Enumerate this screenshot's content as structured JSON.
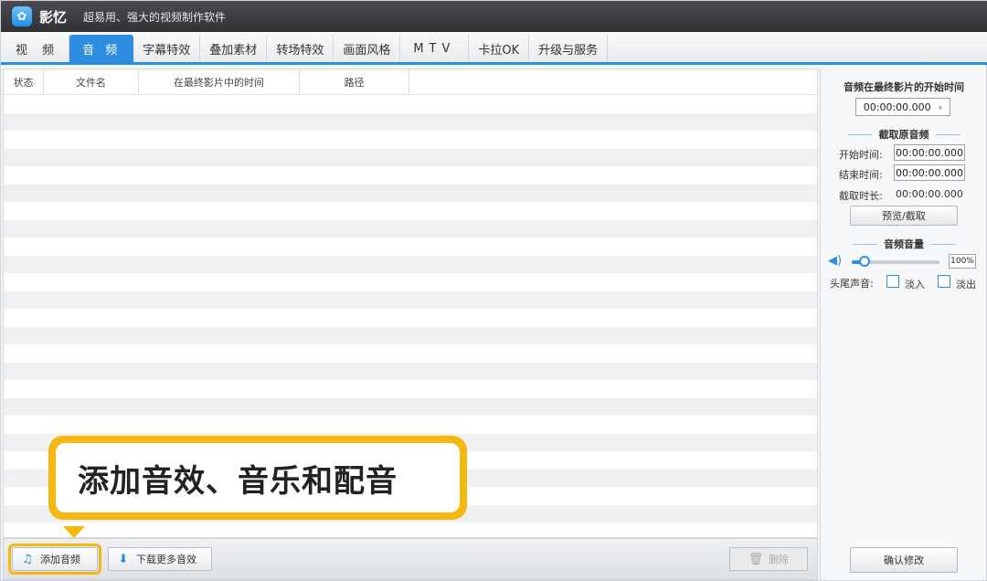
{
  "window": {
    "app_name": "影忆",
    "slogan": "超易用、强大的视频制作软件"
  },
  "tabs": [
    {
      "label": "视 频"
    },
    {
      "label": "音 频"
    },
    {
      "label": "字幕特效"
    },
    {
      "label": "叠加素材"
    },
    {
      "label": "转场特效"
    },
    {
      "label": "画面风格"
    },
    {
      "label": "MTV"
    },
    {
      "label": "卡拉OK"
    },
    {
      "label": "升级与服务"
    }
  ],
  "list": {
    "columns": [
      "状态",
      "文件名",
      "在最终影片中的时间",
      "路径"
    ],
    "rows": []
  },
  "toolbar": {
    "add_audio": "添加音频",
    "download_more": "下载更多音效",
    "delete": "删除"
  },
  "callout": {
    "text": "添加音效、音乐和配音"
  },
  "panel": {
    "start_time_title": "音频在最终影片的开始时间",
    "start_time_value": "00:00:00.000",
    "trim_title": "截取原音频",
    "begin_label": "开始时间:",
    "begin_value": "00:00:00.000",
    "end_label": "结束时间:",
    "end_value": "00:00:00.000",
    "duration_label": "截取时长:",
    "duration_value": "00:00:00.000",
    "preview_button": "预览/截取",
    "volume_title": "音频音量",
    "volume_value": "100%",
    "volume_level": 0.15,
    "fade_label": "头尾声音:",
    "fade_in": "淡入",
    "fade_out": "淡出",
    "bottom_button": "确认修改"
  },
  "colors": {
    "accent": "#2d8de0",
    "callout": "#f5b80f"
  }
}
